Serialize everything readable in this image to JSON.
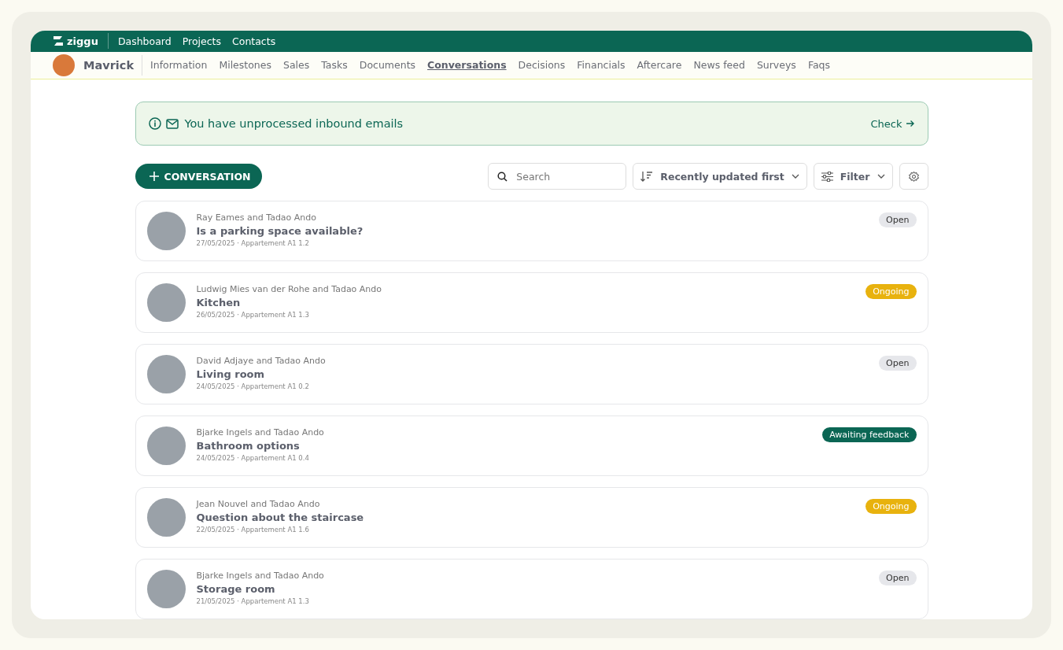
{
  "topbar": {
    "brand": "ziggu",
    "links": [
      "Dashboard",
      "Projects",
      "Contacts"
    ]
  },
  "project": {
    "name": "Mavrick"
  },
  "tabs": [
    {
      "label": "Information",
      "selected": false
    },
    {
      "label": "Milestones",
      "selected": false
    },
    {
      "label": "Sales",
      "selected": false
    },
    {
      "label": "Tasks",
      "selected": false
    },
    {
      "label": "Documents",
      "selected": false
    },
    {
      "label": "Conversations",
      "selected": true
    },
    {
      "label": "Decisions",
      "selected": false
    },
    {
      "label": "Financials",
      "selected": false
    },
    {
      "label": "Aftercare",
      "selected": false
    },
    {
      "label": "News feed",
      "selected": false
    },
    {
      "label": "Surveys",
      "selected": false
    },
    {
      "label": "Faqs",
      "selected": false
    }
  ],
  "alert": {
    "message": "You have unprocessed inbound emails",
    "action": "Check"
  },
  "toolbar": {
    "new_button": "CONVERSATION",
    "search": {
      "placeholder": "Search"
    },
    "sort": "Recently updated first",
    "filter": "Filter"
  },
  "conversations": [
    {
      "participants": "Ray Eames and Tadao Ando",
      "subject": "Is a parking space available?",
      "meta": "27/05/2025 · Appartement A1 1.2",
      "status": {
        "label": "Open",
        "kind": "open"
      }
    },
    {
      "participants": "Ludwig Mies van der Rohe and Tadao Ando",
      "subject": "Kitchen",
      "meta": "26/05/2025 · Appartement A1 1.3",
      "status": {
        "label": "Ongoing",
        "kind": "ongoing"
      }
    },
    {
      "participants": "David Adjaye and Tadao Ando",
      "subject": "Living room",
      "meta": "24/05/2025 · Appartement A1 0.2",
      "status": {
        "label": "Open",
        "kind": "open"
      }
    },
    {
      "participants": "Bjarke Ingels and Tadao Ando",
      "subject": "Bathroom options",
      "meta": "24/05/2025 · Appartement A1 0.4",
      "status": {
        "label": "Awaiting feedback",
        "kind": "awaiting"
      }
    },
    {
      "participants": "Jean Nouvel and Tadao Ando",
      "subject": "Question about the staircase",
      "meta": "22/05/2025 · Appartement A1 1.6",
      "status": {
        "label": "Ongoing",
        "kind": "ongoing"
      }
    },
    {
      "participants": "Bjarke Ingels and Tadao Ando",
      "subject": "Storage room",
      "meta": "21/05/2025 · Appartement A1 1.3",
      "status": {
        "label": "Open",
        "kind": "open"
      }
    }
  ]
}
